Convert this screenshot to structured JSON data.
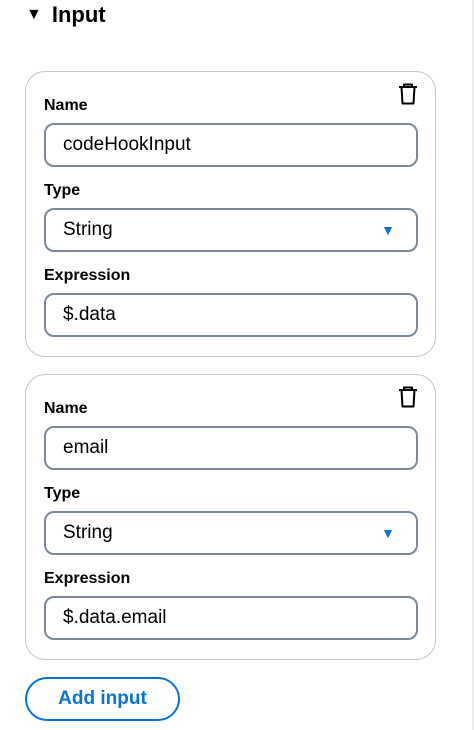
{
  "section": {
    "caret": "▼",
    "title": "Input"
  },
  "inputs": [
    {
      "name_label": "Name",
      "name_value": "codeHookInput",
      "type_label": "Type",
      "type_value": "String",
      "expression_label": "Expression",
      "expression_value": "$.data"
    },
    {
      "name_label": "Name",
      "name_value": "email",
      "type_label": "Type",
      "type_value": "String",
      "expression_label": "Expression",
      "expression_value": "$.data.email"
    }
  ],
  "add_button_label": "Add input",
  "icons": {
    "delete": "trash-icon",
    "dropdown": "caret-down-icon"
  },
  "colors": {
    "accent": "#0972d3",
    "border": "#7d8998",
    "card_border": "#c6c6cd"
  }
}
